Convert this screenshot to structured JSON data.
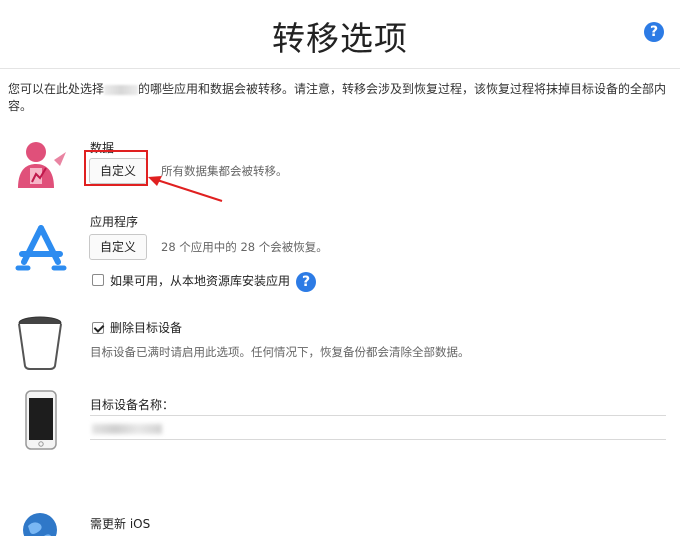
{
  "header": {
    "title": "转移选项",
    "help_icon": "?"
  },
  "intro": {
    "text_before": "您可以在此处选择",
    "text_after": "的哪些应用和数据会被转移。请注意，转移会涉及到恢复过程，该恢复过程将抹掉目标设备的全部内容。"
  },
  "data_section": {
    "label": "数据",
    "customize_button": "自定义",
    "description": "所有数据集都会被转移。"
  },
  "apps_section": {
    "label": "应用程序",
    "customize_button": "自定义",
    "description": "28 个应用中的 28 个会被恢复。",
    "install_checkbox_label": "如果可用，从本地资源库安装应用",
    "install_checked": false,
    "help_icon": "?"
  },
  "erase_section": {
    "checkbox_label": "删除目标设备",
    "checked": true,
    "description": "目标设备已满时请启用此选项。任何情况下，恢复备份都会清除全部数据。"
  },
  "device_name_section": {
    "label": "目标设备名称："
  },
  "ios_section": {
    "label": "需更新 iOS"
  },
  "colors": {
    "accent": "#2c7be5",
    "annotation_red": "#e02020"
  },
  "icons": {
    "data": "person-data-icon",
    "apps": "app-store-icon",
    "erase": "trash-can-icon",
    "device": "iphone-icon",
    "ios": "globe-icon"
  }
}
